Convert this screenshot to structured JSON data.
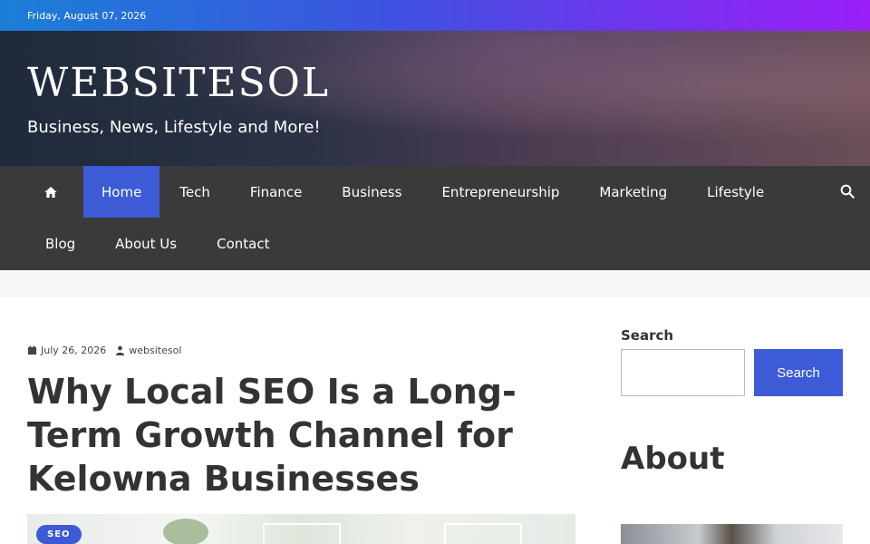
{
  "topbar": {
    "date": "Friday, August 07, 2026"
  },
  "header": {
    "site_title": "WEBSITESOL",
    "tagline": "Business, News, Lifestyle and More!"
  },
  "nav": {
    "home_icon": "home-icon",
    "search_icon": "search-icon",
    "row1": [
      "Home",
      "Tech",
      "Finance",
      "Business",
      "Entrepreneurship",
      "Marketing",
      "Lifestyle"
    ],
    "row2": [
      "Blog",
      "About Us",
      "Contact"
    ],
    "active": "Home"
  },
  "post": {
    "date": "July 26, 2026",
    "author": "websitesol",
    "title": "Why Local SEO Is a Long-Term Growth Channel for Kelowna Businesses",
    "category": "SEO"
  },
  "sidebar": {
    "search_label": "Search",
    "search_button": "Search",
    "search_value": "",
    "about_heading": "About"
  },
  "colors": {
    "accent": "#3d5bd6",
    "nav_bg": "#3a3a3a",
    "topbar_start": "#1b7fd6",
    "topbar_end": "#9a1ff7"
  }
}
